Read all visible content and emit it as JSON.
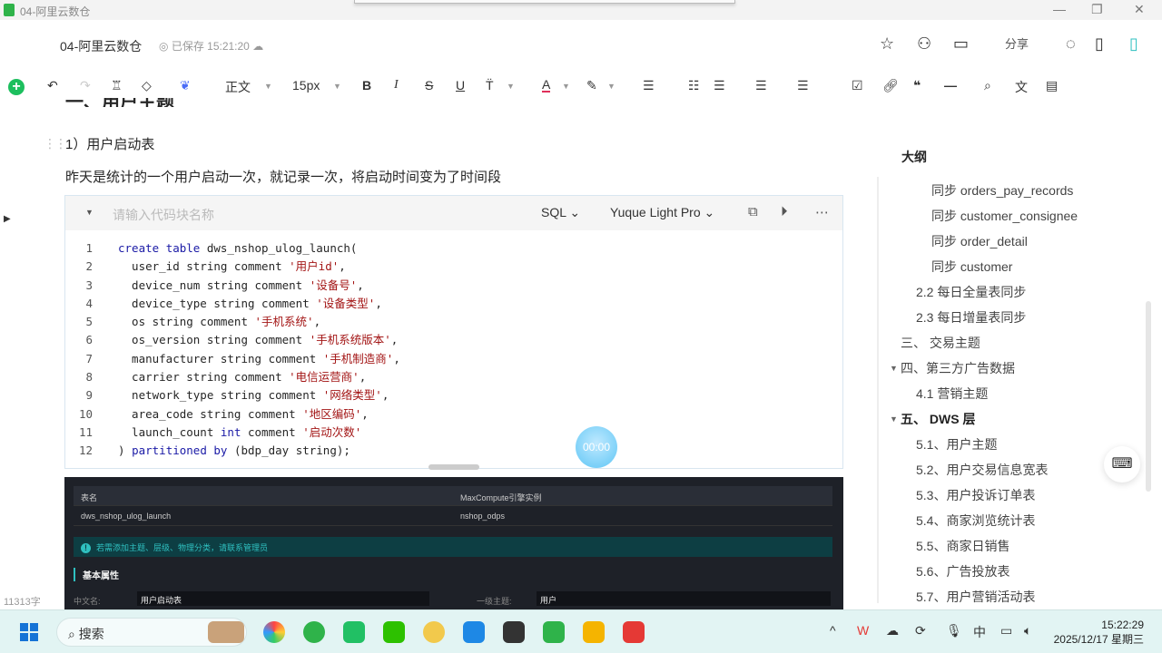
{
  "window": {
    "title": "04-阿里云数仓"
  },
  "header": {
    "doc_title": "04-阿里云数仓",
    "saved_status": "已保存 15:21:20",
    "share_label": "分享"
  },
  "toolbar": {
    "style": "正文",
    "font_size": "15px",
    "bold": "B",
    "italic": "I",
    "strike": "S",
    "underline": "U",
    "font_color": "A"
  },
  "content": {
    "heading_partial": "一、用户主题",
    "subheading": "1）用户启动表",
    "paragraph": "昨天是统计的一个用户启动一次，就记录一次，将启动时间变为了时间段",
    "code_block": {
      "name_placeholder": "请输入代码块名称",
      "language": "SQL",
      "theme": "Yuque Light Pro",
      "lines": [
        "create table dws_nshop_ulog_launch(",
        "  user_id string comment '用户id',",
        "  device_num string comment '设备号',",
        "  device_type string comment '设备类型',",
        "  os string comment '手机系统',",
        "  os_version string comment '手机系统版本',",
        "  manufacturer string comment '手机制造商',",
        "  carrier string comment '电信运营商',",
        "  network_type string comment '网络类型',",
        "  area_code string comment '地区编码',",
        "  launch_count int comment '启动次数'",
        ") partitioned by (bdp_day string);"
      ]
    },
    "timer": "00:00",
    "screenshot": {
      "headers": [
        "表名",
        "MaxCompute引擎实例"
      ],
      "row": [
        "dws_nshop_ulog_launch",
        "nshop_odps"
      ],
      "notice": "若需添加主题、层级、物理分类，请联系管理员",
      "section": "基本属性",
      "cn_name_label": "中文名:",
      "cn_name_value": "用户启动表",
      "topic_label": "一级主题:",
      "topic_value": "用户"
    },
    "word_count": "11313字"
  },
  "outline": {
    "title": "大纲",
    "items": [
      {
        "label": "同步 orders_pay_records",
        "level": 3
      },
      {
        "label": "同步 customer_consignee",
        "level": 3
      },
      {
        "label": "同步 order_detail",
        "level": 3
      },
      {
        "label": "同步 customer",
        "level": 3
      },
      {
        "label": "2.2 每日全量表同步",
        "level": 2
      },
      {
        "label": "2.3 每日增量表同步",
        "level": 2
      },
      {
        "label": "三、 交易主题",
        "level": 1
      },
      {
        "label": "四、第三方广告数据",
        "level": 1,
        "expanded": true
      },
      {
        "label": "4.1 营销主题",
        "level": 2
      },
      {
        "label": "五、 DWS 层",
        "level": 1,
        "expanded": true,
        "bold": true
      },
      {
        "label": "5.1、用户主题",
        "level": 2
      },
      {
        "label": "5.2、用户交易信息宽表",
        "level": 2
      },
      {
        "label": "5.3、用户投诉订单表",
        "level": 2
      },
      {
        "label": "5.4、商家浏览统计表",
        "level": 2
      },
      {
        "label": "5.5、商家日销售",
        "level": 2
      },
      {
        "label": "5.6、广告投放表",
        "level": 2
      },
      {
        "label": "5.7、用户营销活动表",
        "level": 2
      }
    ]
  },
  "taskbar": {
    "search": "搜索",
    "time": "15:22:29",
    "date": "2025/12/17 星期三"
  }
}
